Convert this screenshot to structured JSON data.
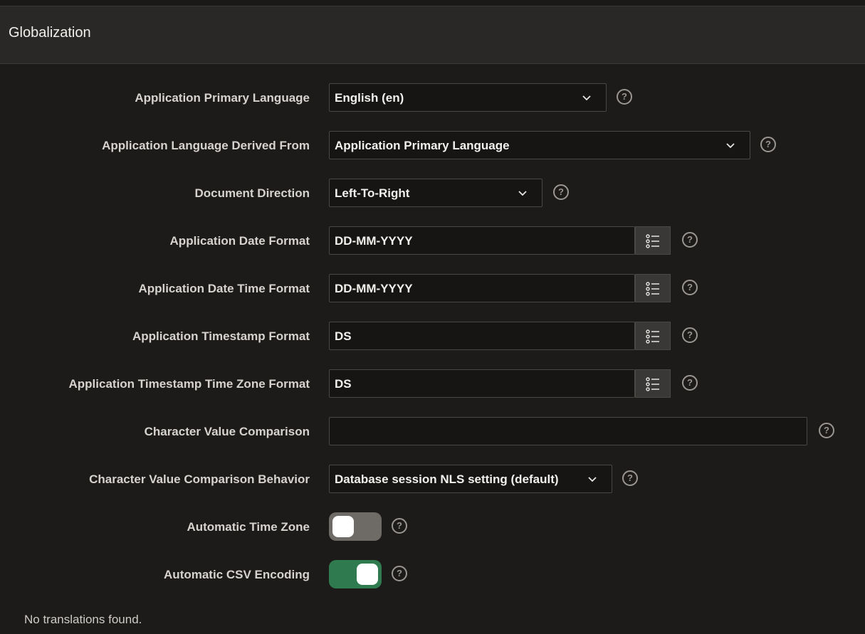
{
  "panel": {
    "title": "Globalization"
  },
  "fields": {
    "primary_language": {
      "label": "Application Primary Language",
      "value": "English (en)"
    },
    "language_derived_from": {
      "label": "Application Language Derived From",
      "value": "Application Primary Language"
    },
    "document_direction": {
      "label": "Document Direction",
      "value": "Left-To-Right"
    },
    "date_format": {
      "label": "Application Date Format",
      "value": "DD-MM-YYYY"
    },
    "date_time_format": {
      "label": "Application Date Time Format",
      "value": "DD-MM-YYYY"
    },
    "timestamp_format": {
      "label": "Application Timestamp Format",
      "value": "DS"
    },
    "timestamp_tz_format": {
      "label": "Application Timestamp Time Zone Format",
      "value": "DS"
    },
    "char_value_comparison": {
      "label": "Character Value Comparison",
      "value": ""
    },
    "char_value_comparison_behavior": {
      "label": "Character Value Comparison Behavior",
      "value": "Database session NLS setting (default)"
    },
    "automatic_time_zone": {
      "label": "Automatic Time Zone",
      "enabled": false
    },
    "automatic_csv_encoding": {
      "label": "Automatic CSV Encoding",
      "enabled": true
    }
  },
  "help_glyph": "?",
  "icons": {
    "select": "chevron-down-icon",
    "lov": "list-icon",
    "help": "help-icon"
  },
  "colors": {
    "toggle_on": "#2f7b4f",
    "toggle_off": "#6e6a66",
    "panel_header": "#2a2826",
    "background": "#1d1b19"
  },
  "footer": {
    "message": "No translations found."
  }
}
